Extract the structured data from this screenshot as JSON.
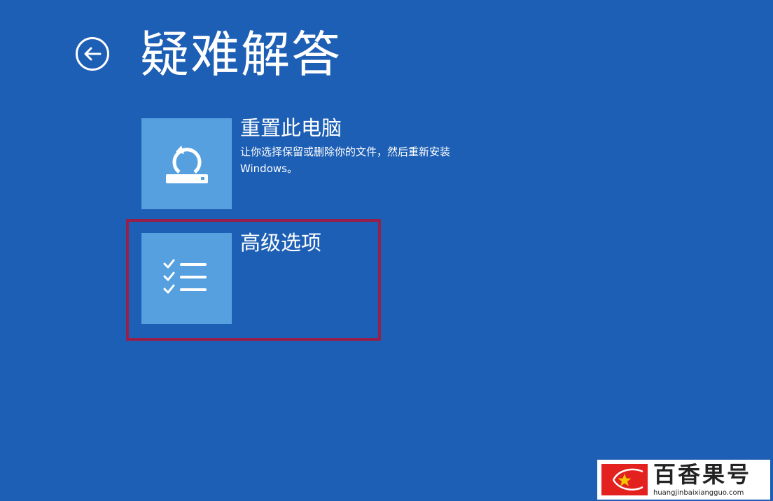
{
  "header": {
    "title": "疑难解答",
    "back_icon": "back-arrow-icon"
  },
  "options": [
    {
      "title": "重置此电脑",
      "description": "让你选择保留或删除你的文件，然后重新安装 Windows。",
      "icon": "reset-pc-icon"
    },
    {
      "title": "高级选项",
      "description": "",
      "icon": "checklist-icon"
    }
  ],
  "watermark": {
    "name": "百香果号",
    "url": "huangjinbaixiangguo.com",
    "logo_icon": "star-logo-icon"
  },
  "colors": {
    "background": "#1d5fb4",
    "tile": "#57a0e0",
    "highlight": "#96204a",
    "watermark_red": "#e3211e",
    "watermark_star": "#f5c400"
  }
}
